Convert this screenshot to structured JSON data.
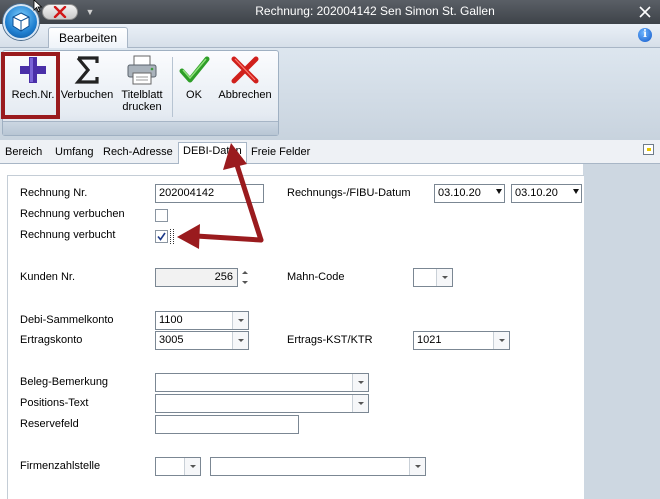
{
  "window": {
    "title": "Rechnung: 202004142 Sen Simon St. Gallen"
  },
  "ribbon": {
    "tab_label": "Bearbeiten",
    "buttons": [
      {
        "label": "Rech.Nr.",
        "icon": "plus-icon"
      },
      {
        "label": "Verbuchen",
        "icon": "sigma-icon"
      },
      {
        "label": "Titelblatt drucken",
        "icon": "printer-icon"
      },
      {
        "label": "OK",
        "icon": "checkmark-icon"
      },
      {
        "label": "Abbrechen",
        "icon": "cross-icon"
      }
    ]
  },
  "form_tabs": [
    {
      "label": "Bereich",
      "active": false
    },
    {
      "label": "Umfang",
      "active": false
    },
    {
      "label": "Rech-Adresse",
      "active": false
    },
    {
      "label": "DEBI-Daten",
      "active": true
    },
    {
      "label": "Freie Felder",
      "active": false
    }
  ],
  "fields": {
    "rechnung_nr": {
      "label": "Rechnung Nr.",
      "value": "202004142"
    },
    "datum": {
      "label": "Rechnungs-/FIBU-Datum",
      "value1": "03.10.20",
      "value2": "03.10.20"
    },
    "verbuchen": {
      "label": "Rechnung verbuchen",
      "checked": false
    },
    "verbucht": {
      "label": "Rechnung verbucht",
      "checked": true
    },
    "kunden_nr": {
      "label": "Kunden Nr.",
      "value": "256"
    },
    "mahn_code": {
      "label": "Mahn-Code",
      "value": ""
    },
    "debi_sammelkonto": {
      "label": "Debi-Sammelkonto",
      "value": "1100"
    },
    "ertragskonto": {
      "label": "Ertragskonto",
      "value": "3005"
    },
    "ertrags_kst": {
      "label": "Ertrags-KST/KTR",
      "value": "1021"
    },
    "beleg_bemerkung": {
      "label": "Beleg-Bemerkung",
      "value": ""
    },
    "positions_text": {
      "label": "Positions-Text",
      "value": ""
    },
    "reservefeld": {
      "label": "Reservefeld",
      "value": ""
    },
    "firmenzahlstelle": {
      "label": "Firmenzahlstelle",
      "value1": "",
      "value2": ""
    }
  },
  "colors": {
    "annotation": "#9a1b1e",
    "titlebar": "#4a4f55",
    "ribbon": "#dde6ef"
  }
}
